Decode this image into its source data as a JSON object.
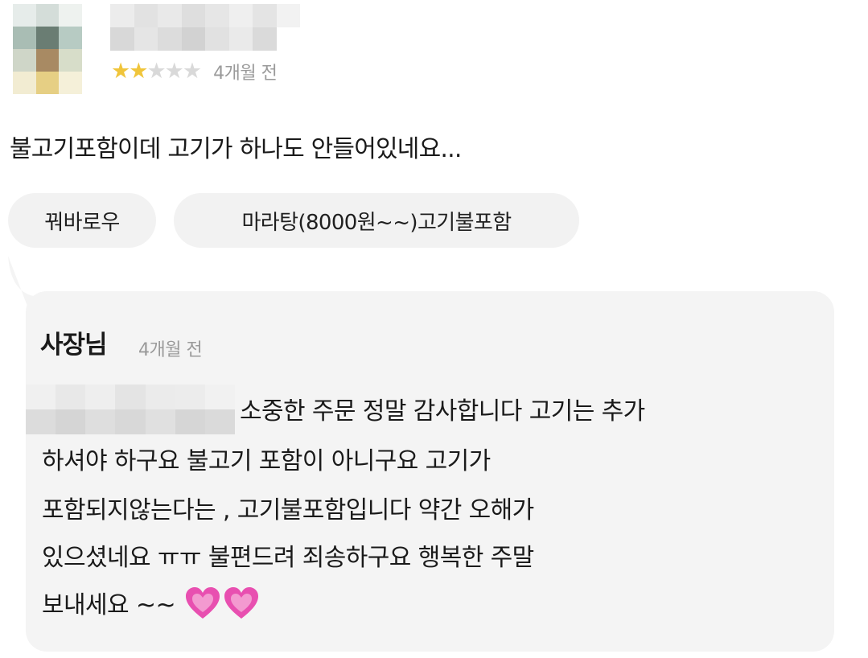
{
  "review": {
    "rating": 2,
    "rating_max": 5,
    "time": "4개월 전",
    "text": "불고기포함이데 고기가 하나도 안들어있네요...",
    "menu_tags": [
      "꿔바로우",
      "마라탕(8000원~~)고기불포함"
    ]
  },
  "owner_reply": {
    "label": "사장님",
    "time": "4개월 전",
    "lines": [
      "소중한 주문 정말 감사합니다  고기는 추가",
      "하셔야 하구요 불고기 포함이 아니구요 고기가",
      "포함되지않는다는 , 고기불포함입니다 약간 오해가",
      "있으셨네요 ㅠㅠ 불편드려 죄송하구요 행복한 주말",
      "보내세요 ~~"
    ],
    "heart_icons": [
      "heart-icon",
      "heart-icon"
    ]
  },
  "colors": {
    "star_on": "#f0c53b",
    "star_off": "#d9d9d9",
    "chip_bg": "#f2f2f2",
    "bubble_bg": "#f4f4f4",
    "muted_text": "#9a9a9a",
    "heart": "#e84fb0"
  }
}
